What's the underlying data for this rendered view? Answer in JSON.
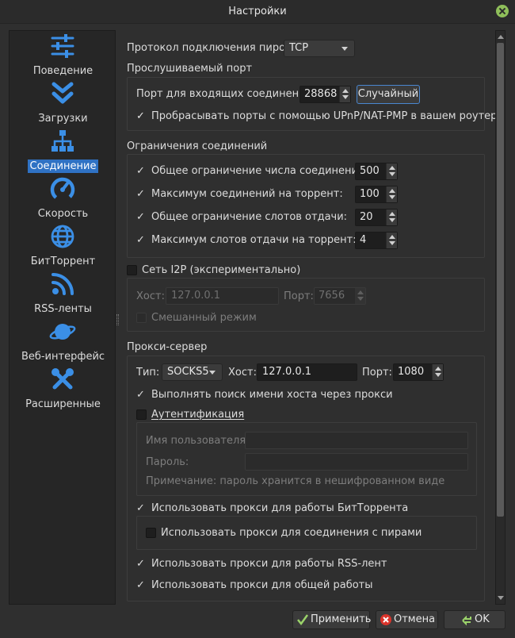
{
  "window": {
    "title": "Настройки"
  },
  "sidebar": {
    "items": [
      {
        "label": "Поведение",
        "icon": "sliders-icon"
      },
      {
        "label": "Загрузки",
        "icon": "download-chevrons-icon"
      },
      {
        "label": "Соединение",
        "icon": "network-icon",
        "active": true
      },
      {
        "label": "Скорость",
        "icon": "speedometer-icon"
      },
      {
        "label": "БитТоррент",
        "icon": "globe-icon"
      },
      {
        "label": "RSS-ленты",
        "icon": "rss-icon"
      },
      {
        "label": "Веб-интерфейс",
        "icon": "planet-icon"
      },
      {
        "label": "Расширенные",
        "icon": "tools-icon"
      }
    ]
  },
  "connection": {
    "protocol_label": "Протокол подключения пиров:",
    "protocol_value": "TCP",
    "listening": {
      "title": "Прослушиваемый порт",
      "port_label": "Порт для входящих соединений:",
      "port_value": "28868",
      "random_button": "Случайный",
      "upnp_label": "Пробрасывать порты с помощью UPnP/NAT-PMP в вашем роутере"
    },
    "limits": {
      "title": "Ограничения соединений",
      "rows": [
        {
          "label": "Общее ограничение числа соединений:",
          "value": "500"
        },
        {
          "label": "Максимум соединений на торрент:",
          "value": "100"
        },
        {
          "label": "Общее ограничение слотов отдачи:",
          "value": "20"
        },
        {
          "label": "Максимум слотов отдачи на торрент:",
          "value": "4"
        }
      ]
    },
    "i2p": {
      "title": "Сеть I2P (экспериментально)",
      "host_label": "Хост:",
      "host_value": "127.0.0.1",
      "port_label": "Порт:",
      "port_value": "7656",
      "mixed_label": "Смешанный режим"
    },
    "proxy": {
      "title": "Прокси-сервер",
      "type_label": "Тип:",
      "type_value": "SOCKS5",
      "host_label": "Хост:",
      "host_value": "127.0.0.1",
      "port_label": "Порт:",
      "port_value": "1080",
      "hostname_lookup_label": "Выполнять поиск имени хоста через прокси",
      "auth_label": "Аутентификация",
      "username_label": "Имя пользователя:",
      "username_value": "",
      "password_label": "Пароль:",
      "password_value": "",
      "note": "Примечание: пароль хранится в нешифрованном виде",
      "bittorrent_label": "Использовать прокси для работы БитТоррента",
      "peers_label": "Использовать прокси для соединения с пирами",
      "rss_label": "Использовать прокси для работы RSS-лент",
      "general_label": "Использовать прокси для общей работы"
    }
  },
  "footer": {
    "apply": "Применить",
    "cancel": "Отмена",
    "ok": "OK"
  },
  "colors": {
    "accent": "#2f72c4",
    "icon_blue": "#3b8fe6",
    "close_green": "#8fbf5a"
  }
}
